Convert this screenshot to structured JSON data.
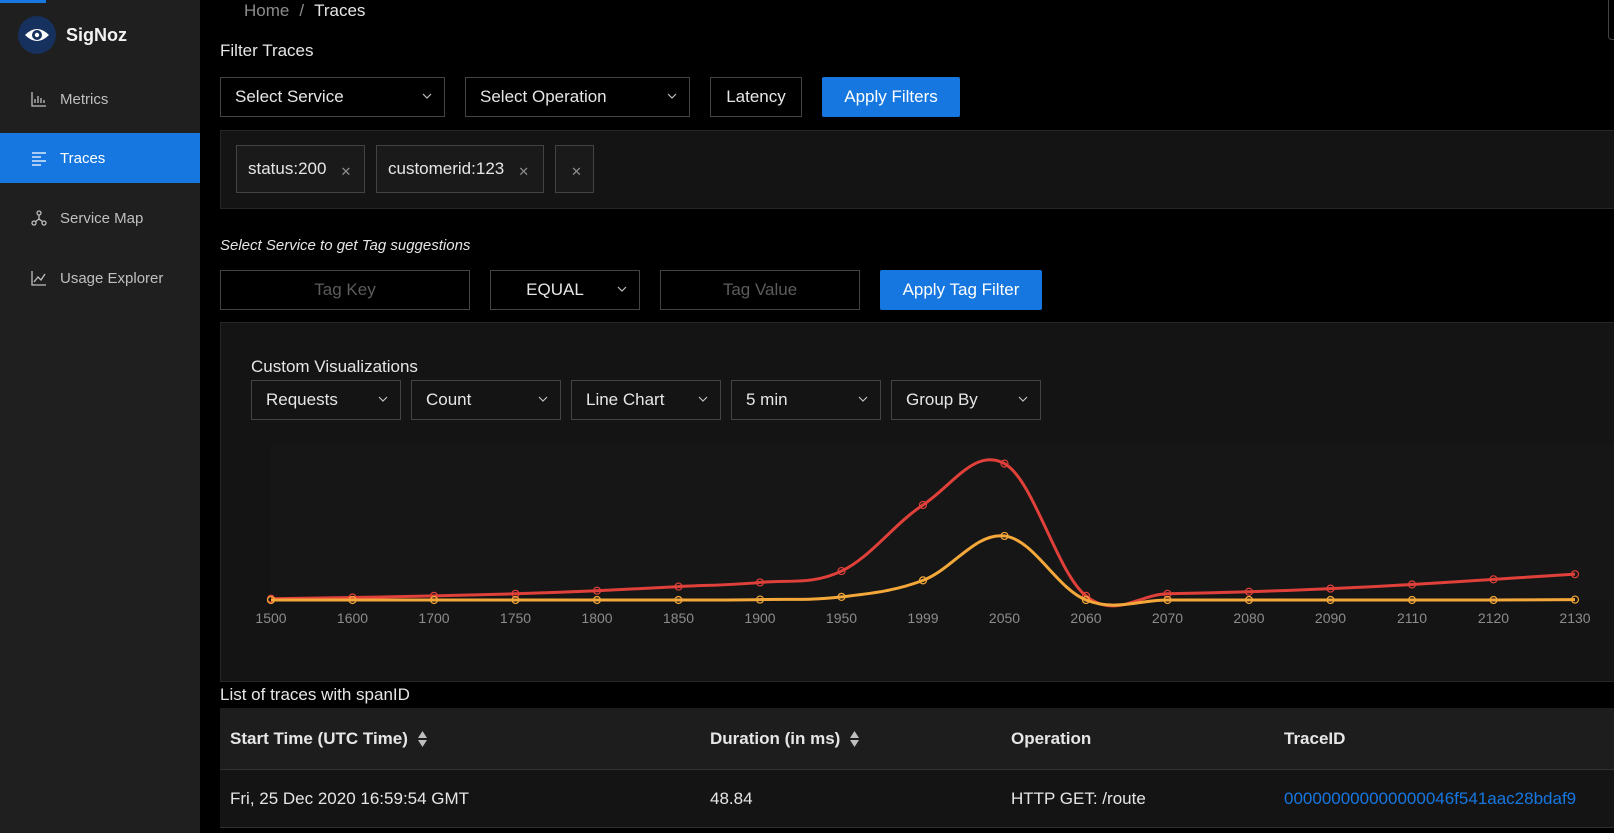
{
  "app": {
    "name": "SigNoz"
  },
  "sidebar": {
    "items": [
      {
        "label": "Metrics",
        "icon": "bar-chart-icon",
        "active": false
      },
      {
        "label": "Traces",
        "icon": "align-left-icon",
        "active": true
      },
      {
        "label": "Service Map",
        "icon": "deployment-unit-icon",
        "active": false
      },
      {
        "label": "Usage Explorer",
        "icon": "line-chart-icon",
        "active": false
      }
    ]
  },
  "breadcrumb": {
    "home": "Home",
    "separator": "/",
    "current": "Traces"
  },
  "filter": {
    "title": "Filter Traces",
    "service_placeholder": "Select Service",
    "operation_placeholder": "Select Operation",
    "latency_label": "Latency",
    "apply_label": "Apply Filters"
  },
  "tags": [
    {
      "label": "status:200"
    },
    {
      "label": "customerid:123"
    },
    {
      "label": ""
    }
  ],
  "tag_filter": {
    "hint": "Select Service to get Tag suggestions",
    "key_placeholder": "Tag Key",
    "operator": "EQUAL",
    "value_placeholder": "Tag Value",
    "apply_label": "Apply Tag Filter"
  },
  "visualization": {
    "title": "Custom Visualizations",
    "entity": "Requests",
    "aggregation": "Count",
    "chart_type": "Line Chart",
    "interval": "5 min",
    "group_by": "Group By"
  },
  "chart_data": {
    "type": "line",
    "categories": [
      "1500",
      "1600",
      "1700",
      "1750",
      "1800",
      "1850",
      "1900",
      "1950",
      "1999",
      "2050",
      "2060",
      "2070",
      "2080",
      "2090",
      "2110",
      "2120",
      "2130"
    ],
    "series": [
      {
        "color": "#e0403a",
        "values": [
          0.6,
          1.2,
          2.0,
          3.0,
          4.5,
          6.5,
          8.5,
          14.0,
          46.0,
          66.0,
          2.0,
          3.0,
          4.0,
          5.5,
          7.5,
          10.0,
          12.5
        ]
      },
      {
        "color": "#f5a83a",
        "values": [
          0,
          0,
          0,
          0,
          0,
          0,
          0.2,
          1.5,
          9.5,
          31.0,
          0,
          0,
          0,
          0,
          0,
          0,
          0.2
        ]
      }
    ],
    "ylim": [
      0,
      75
    ],
    "grid": false
  },
  "traces_list": {
    "title": "List of traces with spanID",
    "columns": [
      "Start Time (UTC Time)",
      "Duration (in ms)",
      "Operation",
      "TraceID"
    ],
    "rows": [
      {
        "start_time": "Fri, 25 Dec 2020 16:59:54 GMT",
        "duration": "48.84",
        "operation": "HTTP GET: /route",
        "trace_id": "000000000000000046f541aac28bdaf9"
      }
    ]
  }
}
